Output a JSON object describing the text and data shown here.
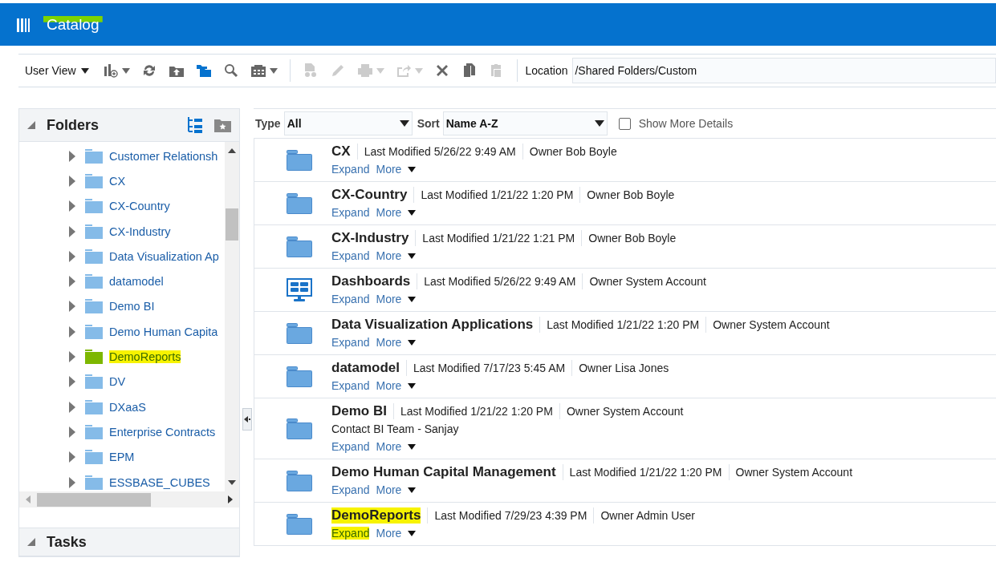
{
  "header": {
    "title": "Catalog",
    "highlighted": true
  },
  "toolbar": {
    "view_menu": "User View",
    "buttons": [
      {
        "disabled": false,
        "menu": true
      },
      {
        "disabled": false,
        "menu": false
      },
      {
        "disabled": false,
        "menu": false
      },
      {
        "disabled": false,
        "menu": false
      },
      {
        "disabled": false,
        "menu": false
      },
      {
        "disabled": false,
        "menu": true
      },
      {
        "disabled": true,
        "menu": false
      },
      {
        "disabled": true,
        "menu": false
      },
      {
        "disabled": true,
        "menu": true
      },
      {
        "disabled": true,
        "menu": true
      },
      {
        "disabled": false,
        "menu": false
      },
      {
        "disabled": false,
        "menu": false
      },
      {
        "disabled": true,
        "menu": false
      }
    ],
    "location_label": "Location",
    "location": "/Shared Folders/Custom"
  },
  "folders": {
    "title": "Folders",
    "expanded": true,
    "items": [
      {
        "label": "Customer Relationsh",
        "highlighted": false
      },
      {
        "label": "CX",
        "highlighted": false
      },
      {
        "label": "CX-Country",
        "highlighted": false
      },
      {
        "label": "CX-Industry",
        "highlighted": false
      },
      {
        "label": "Data Visualization Ap",
        "highlighted": false
      },
      {
        "label": "datamodel",
        "highlighted": false
      },
      {
        "label": "Demo BI",
        "highlighted": false
      },
      {
        "label": "Demo Human Capita",
        "highlighted": false
      },
      {
        "label": "DemoReports",
        "highlighted": true
      },
      {
        "label": "DV",
        "highlighted": false
      },
      {
        "label": "DXaaS",
        "highlighted": false
      },
      {
        "label": "Enterprise Contracts",
        "highlighted": false
      },
      {
        "label": "EPM",
        "highlighted": false
      },
      {
        "label": "ESSBASE_CUBES",
        "highlighted": false
      }
    ]
  },
  "tasks": {
    "title": "Tasks",
    "expanded": true
  },
  "filters": {
    "type_label": "Type",
    "type": "All",
    "sort_label": "Sort",
    "sort": "Name A-Z",
    "details_label": "Show More Details",
    "details_checked": false
  },
  "items": [
    {
      "kind": "folder",
      "name": "CX",
      "modified": "Last Modified 5/26/22 9:49 AM",
      "owner": "Owner Bob Boyle",
      "expand": "Expand",
      "more": "More",
      "highlighted": false
    },
    {
      "kind": "folder",
      "name": "CX-Country",
      "modified": "Last Modified 1/21/22 1:20 PM",
      "owner": "Owner Bob Boyle",
      "expand": "Expand",
      "more": "More",
      "highlighted": false
    },
    {
      "kind": "folder",
      "name": "CX-Industry",
      "modified": "Last Modified 1/21/22 1:21 PM",
      "owner": "Owner Bob Boyle",
      "expand": "Expand",
      "more": "More",
      "highlighted": false
    },
    {
      "kind": "dashboard",
      "name": "Dashboards",
      "modified": "Last Modified 5/26/22 9:49 AM",
      "owner": "Owner System Account",
      "expand": "Expand",
      "more": "More",
      "highlighted": false
    },
    {
      "kind": "folder",
      "name": "Data Visualization Applications",
      "modified": "Last Modified 1/21/22 1:20 PM",
      "owner": "Owner System Account",
      "expand": "Expand",
      "more": "More",
      "highlighted": false
    },
    {
      "kind": "folder",
      "name": "datamodel",
      "modified": "Last Modified 7/17/23 5:45 AM",
      "owner": "Owner Lisa Jones",
      "expand": "Expand",
      "more": "More",
      "highlighted": false
    },
    {
      "kind": "folder",
      "name": "Demo BI",
      "modified": "Last Modified 1/21/22 1:20 PM",
      "owner": "Owner System Account",
      "description": "Contact BI Team - Sanjay",
      "expand": "Expand",
      "more": "More",
      "highlighted": false
    },
    {
      "kind": "folder",
      "name": "Demo Human Capital Management",
      "modified": "Last Modified 1/21/22 1:20 PM",
      "owner": "Owner System Account",
      "expand": "Expand",
      "more": "More",
      "highlighted": false
    },
    {
      "kind": "folder",
      "name": "DemoReports",
      "modified": "Last Modified 7/29/23 4:39 PM",
      "owner": "Owner Admin User",
      "expand": "Expand",
      "more": "More",
      "highlighted": true
    }
  ]
}
